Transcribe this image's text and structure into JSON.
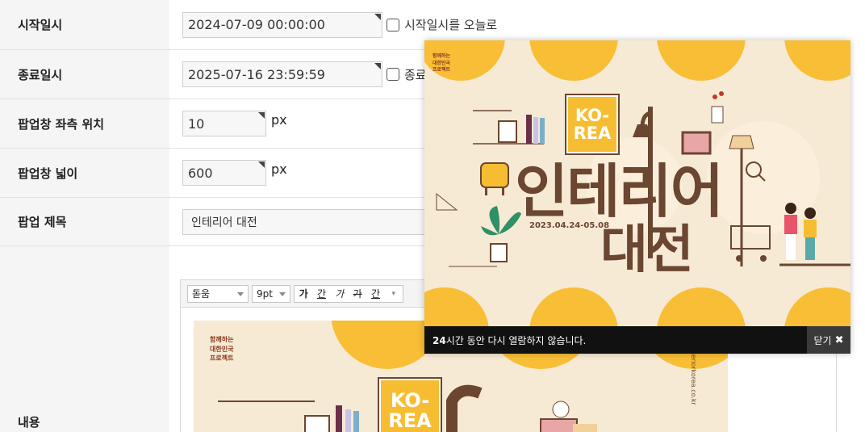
{
  "form": {
    "start": {
      "label": "시작일시",
      "value": "2024-07-09 00:00:00",
      "checkbox_label": "시작일시를 오늘로"
    },
    "end": {
      "label": "종료일시",
      "value": "2025-07-16 23:59:59",
      "checkbox_label": "종료"
    },
    "left_pos": {
      "label": "팝업창 좌측 위치",
      "value": "10",
      "unit": "px"
    },
    "width": {
      "label": "팝업창 넓이",
      "value": "600",
      "unit": "px"
    },
    "title": {
      "label": "팝업 제목",
      "value": "인테리어 대전"
    },
    "content": {
      "label": "내용"
    }
  },
  "editor": {
    "font_select": "돋움",
    "size_select": "9pt",
    "format_buttons": [
      "가",
      "간",
      "가",
      "가",
      "간"
    ]
  },
  "banner": {
    "side_text": [
      "함께하는",
      "대한민국",
      "프로젝트"
    ],
    "badge_line1": "KO-",
    "badge_line2": "REA",
    "title_line1": "인테리어",
    "title_line2": "대전",
    "date_range": "2023.04.24-05.08",
    "site_text": "www.interiorkorea.co.kr"
  },
  "popup": {
    "footer_bold": "24",
    "footer_msg": "시간 동안 다시 열람하지 않습니다.",
    "close_label": "닫기",
    "close_icon": "close-x-icon"
  },
  "colors": {
    "accent_yellow": "#f8be35",
    "brown": "#6b4631",
    "cream": "#f6ead5"
  }
}
